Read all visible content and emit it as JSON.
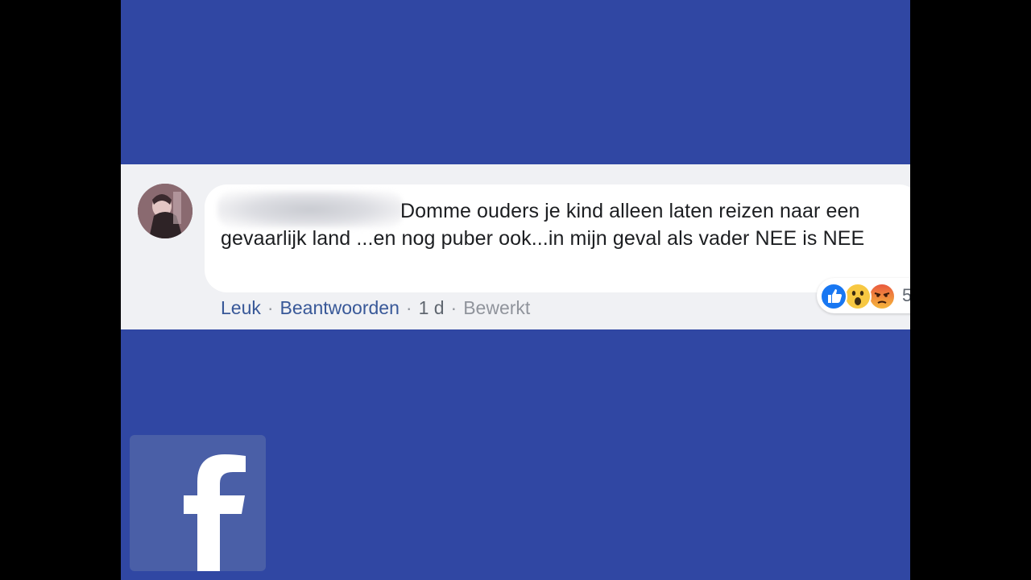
{
  "comment": {
    "author_name_blurred": "",
    "text": "Domme ouders je kind alleen laten reizen naar een gevaarlijk land ...en nog puber ook...in mijn geval als vader NEE is NEE",
    "actions": {
      "like_label": "Leuk",
      "reply_label": "Beantwoorden",
      "separator": "·",
      "time": "1 d",
      "edited_label": "Bewerkt"
    },
    "reactions": {
      "icons": [
        "like-reaction-icon",
        "wow-reaction-icon",
        "angry-reaction-icon"
      ],
      "count": "5"
    }
  },
  "branding": {
    "logo_icon": "facebook-logo-icon"
  },
  "colors": {
    "background_blue": "#3047a3",
    "link_blue": "#385898",
    "strip_gray": "#f0f1f4",
    "logo_tile": "#4a5fa7"
  }
}
